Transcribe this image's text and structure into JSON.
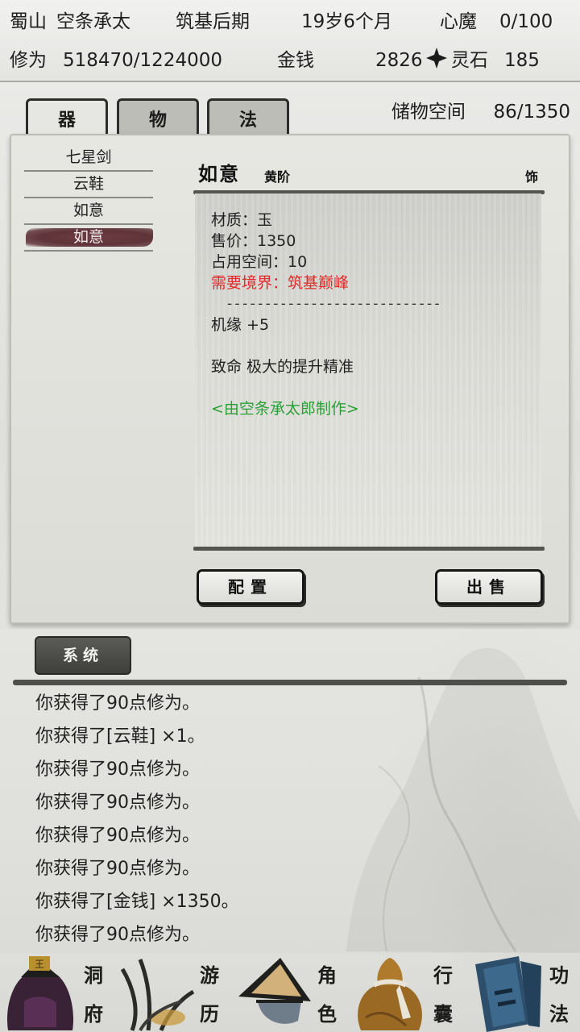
{
  "header": {
    "location": "蜀山",
    "player_name": "空条承太",
    "realm": "筑基后期",
    "age": "19岁6个月",
    "demon_label": "心魔",
    "demon_value": "0/100",
    "cultivation_label": "修为",
    "cultivation_value": "518470/1224000",
    "money_label": "金钱",
    "money_value": "2826",
    "spirit_stone_label": "灵石",
    "spirit_stone_value": "185"
  },
  "tabs": [
    {
      "label": "器",
      "active": true
    },
    {
      "label": "物",
      "active": false
    },
    {
      "label": "法",
      "active": false
    }
  ],
  "storage": {
    "label": "储物空间",
    "value": "86/1350"
  },
  "items": [
    {
      "name": "七星剑",
      "selected": false
    },
    {
      "name": "云鞋",
      "selected": false
    },
    {
      "name": "如意",
      "selected": false
    },
    {
      "name": "如意",
      "selected": true
    }
  ],
  "detail": {
    "name": "如意",
    "rank": "黄阶",
    "type": "饰",
    "material": "材质：玉",
    "price": "售价：1350",
    "space": "占用空间：10",
    "requirement": "需要境界：筑基巅峰",
    "divider": "- - - - - - - - - - - - - - - - - - - - - - - - - - - -",
    "stat": "机缘 +5",
    "special": "致命 极大的提升精准",
    "maker": "<由空条承太郎制作>"
  },
  "actions": {
    "equip": "配置",
    "sell": "出售"
  },
  "system": {
    "tab_label": "系统",
    "log": [
      "你获得了90点修为。",
      "你获得了[云鞋] ×1。",
      "你获得了90点修为。",
      "你获得了90点修为。",
      "你获得了90点修为。",
      "你获得了90点修为。",
      "你获得了[金钱] ×1350。",
      "你获得了90点修为。"
    ]
  },
  "nav": [
    {
      "chars": [
        "洞",
        "府"
      ],
      "icon": "cave-dwelling-icon"
    },
    {
      "chars": [
        "游",
        "历"
      ],
      "icon": "travel-grass-icon"
    },
    {
      "chars": [
        "角",
        "色"
      ],
      "icon": "character-hat-icon"
    },
    {
      "chars": [
        "行",
        "囊"
      ],
      "icon": "inventory-bag-icon"
    },
    {
      "chars": [
        "功",
        "法"
      ],
      "icon": "technique-book-icon"
    }
  ],
  "colors": {
    "requirement_red": "#e12a2a",
    "maker_green": "#2b9f38",
    "selected_item_bg": "#5f3439"
  }
}
